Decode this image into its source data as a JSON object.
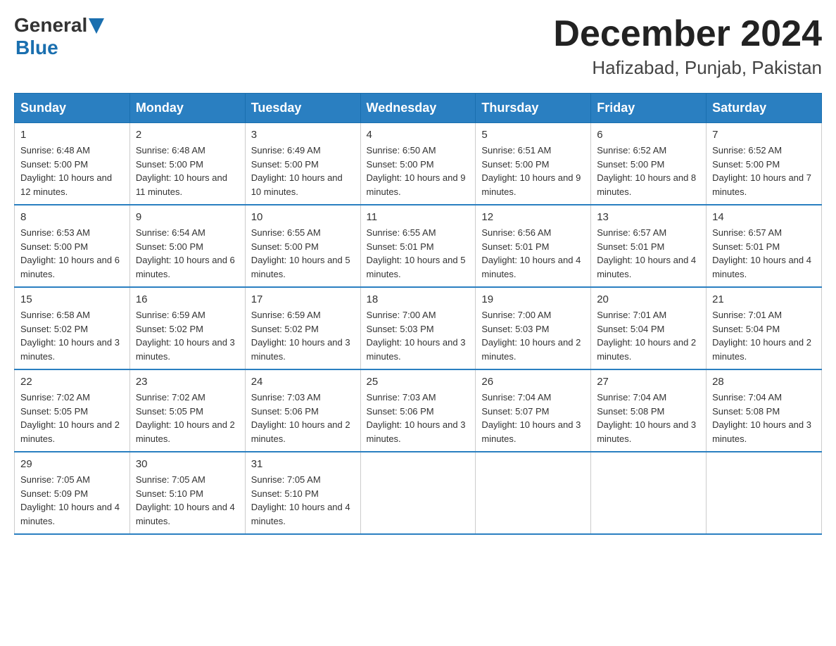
{
  "header": {
    "logo_general": "General",
    "logo_blue": "Blue",
    "month_title": "December 2024",
    "location": "Hafizabad, Punjab, Pakistan"
  },
  "days_of_week": [
    "Sunday",
    "Monday",
    "Tuesday",
    "Wednesday",
    "Thursday",
    "Friday",
    "Saturday"
  ],
  "weeks": [
    [
      {
        "day": "1",
        "sunrise": "6:48 AM",
        "sunset": "5:00 PM",
        "daylight": "10 hours and 12 minutes."
      },
      {
        "day": "2",
        "sunrise": "6:48 AM",
        "sunset": "5:00 PM",
        "daylight": "10 hours and 11 minutes."
      },
      {
        "day": "3",
        "sunrise": "6:49 AM",
        "sunset": "5:00 PM",
        "daylight": "10 hours and 10 minutes."
      },
      {
        "day": "4",
        "sunrise": "6:50 AM",
        "sunset": "5:00 PM",
        "daylight": "10 hours and 9 minutes."
      },
      {
        "day": "5",
        "sunrise": "6:51 AM",
        "sunset": "5:00 PM",
        "daylight": "10 hours and 9 minutes."
      },
      {
        "day": "6",
        "sunrise": "6:52 AM",
        "sunset": "5:00 PM",
        "daylight": "10 hours and 8 minutes."
      },
      {
        "day": "7",
        "sunrise": "6:52 AM",
        "sunset": "5:00 PM",
        "daylight": "10 hours and 7 minutes."
      }
    ],
    [
      {
        "day": "8",
        "sunrise": "6:53 AM",
        "sunset": "5:00 PM",
        "daylight": "10 hours and 6 minutes."
      },
      {
        "day": "9",
        "sunrise": "6:54 AM",
        "sunset": "5:00 PM",
        "daylight": "10 hours and 6 minutes."
      },
      {
        "day": "10",
        "sunrise": "6:55 AM",
        "sunset": "5:00 PM",
        "daylight": "10 hours and 5 minutes."
      },
      {
        "day": "11",
        "sunrise": "6:55 AM",
        "sunset": "5:01 PM",
        "daylight": "10 hours and 5 minutes."
      },
      {
        "day": "12",
        "sunrise": "6:56 AM",
        "sunset": "5:01 PM",
        "daylight": "10 hours and 4 minutes."
      },
      {
        "day": "13",
        "sunrise": "6:57 AM",
        "sunset": "5:01 PM",
        "daylight": "10 hours and 4 minutes."
      },
      {
        "day": "14",
        "sunrise": "6:57 AM",
        "sunset": "5:01 PM",
        "daylight": "10 hours and 4 minutes."
      }
    ],
    [
      {
        "day": "15",
        "sunrise": "6:58 AM",
        "sunset": "5:02 PM",
        "daylight": "10 hours and 3 minutes."
      },
      {
        "day": "16",
        "sunrise": "6:59 AM",
        "sunset": "5:02 PM",
        "daylight": "10 hours and 3 minutes."
      },
      {
        "day": "17",
        "sunrise": "6:59 AM",
        "sunset": "5:02 PM",
        "daylight": "10 hours and 3 minutes."
      },
      {
        "day": "18",
        "sunrise": "7:00 AM",
        "sunset": "5:03 PM",
        "daylight": "10 hours and 3 minutes."
      },
      {
        "day": "19",
        "sunrise": "7:00 AM",
        "sunset": "5:03 PM",
        "daylight": "10 hours and 2 minutes."
      },
      {
        "day": "20",
        "sunrise": "7:01 AM",
        "sunset": "5:04 PM",
        "daylight": "10 hours and 2 minutes."
      },
      {
        "day": "21",
        "sunrise": "7:01 AM",
        "sunset": "5:04 PM",
        "daylight": "10 hours and 2 minutes."
      }
    ],
    [
      {
        "day": "22",
        "sunrise": "7:02 AM",
        "sunset": "5:05 PM",
        "daylight": "10 hours and 2 minutes."
      },
      {
        "day": "23",
        "sunrise": "7:02 AM",
        "sunset": "5:05 PM",
        "daylight": "10 hours and 2 minutes."
      },
      {
        "day": "24",
        "sunrise": "7:03 AM",
        "sunset": "5:06 PM",
        "daylight": "10 hours and 2 minutes."
      },
      {
        "day": "25",
        "sunrise": "7:03 AM",
        "sunset": "5:06 PM",
        "daylight": "10 hours and 3 minutes."
      },
      {
        "day": "26",
        "sunrise": "7:04 AM",
        "sunset": "5:07 PM",
        "daylight": "10 hours and 3 minutes."
      },
      {
        "day": "27",
        "sunrise": "7:04 AM",
        "sunset": "5:08 PM",
        "daylight": "10 hours and 3 minutes."
      },
      {
        "day": "28",
        "sunrise": "7:04 AM",
        "sunset": "5:08 PM",
        "daylight": "10 hours and 3 minutes."
      }
    ],
    [
      {
        "day": "29",
        "sunrise": "7:05 AM",
        "sunset": "5:09 PM",
        "daylight": "10 hours and 4 minutes."
      },
      {
        "day": "30",
        "sunrise": "7:05 AM",
        "sunset": "5:10 PM",
        "daylight": "10 hours and 4 minutes."
      },
      {
        "day": "31",
        "sunrise": "7:05 AM",
        "sunset": "5:10 PM",
        "daylight": "10 hours and 4 minutes."
      },
      null,
      null,
      null,
      null
    ]
  ]
}
